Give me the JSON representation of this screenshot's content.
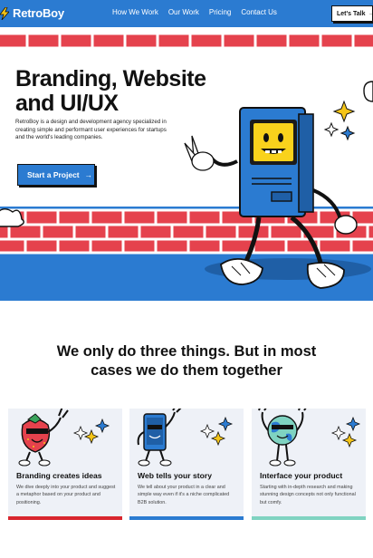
{
  "header": {
    "logo_text": "RetroBoy",
    "nav": [
      "How We Work",
      "Our Work",
      "Pricing",
      "Contact Us"
    ],
    "cta_label": "Let's Talk",
    "cta_arrow": "→"
  },
  "hero": {
    "title": "Branding, Website and UI/UX",
    "description": "RetroBoy is a design and development agency specialized in creating simple and performant user experiences for startups and the world's leading companies.",
    "button_label": "Start a Project",
    "button_arrow": "→"
  },
  "section": {
    "title": "We only do three things. But in most cases we do them together"
  },
  "cards": [
    {
      "title": "Branding creates ideas",
      "description": "We dive deeply into your product and suggest a metaphor based on your product and positioning.",
      "accent": "#d8262e",
      "icon": "strawberry-mascot-icon"
    },
    {
      "title": "Web tells your story",
      "description": "We tell about your product in a clear and simple way even if it's a niche complicated B2B solution.",
      "accent": "#2b7bd1",
      "icon": "phone-mascot-icon"
    },
    {
      "title": "Interface your product",
      "description": "Starting with in-depth research and making stunning design concepts not only functional but comfy.",
      "accent": "#7fd3c1",
      "icon": "globe-mascot-icon"
    }
  ],
  "colors": {
    "brand_blue": "#2b7bd1",
    "brick_red": "#e5424d",
    "dark": "#111111"
  }
}
